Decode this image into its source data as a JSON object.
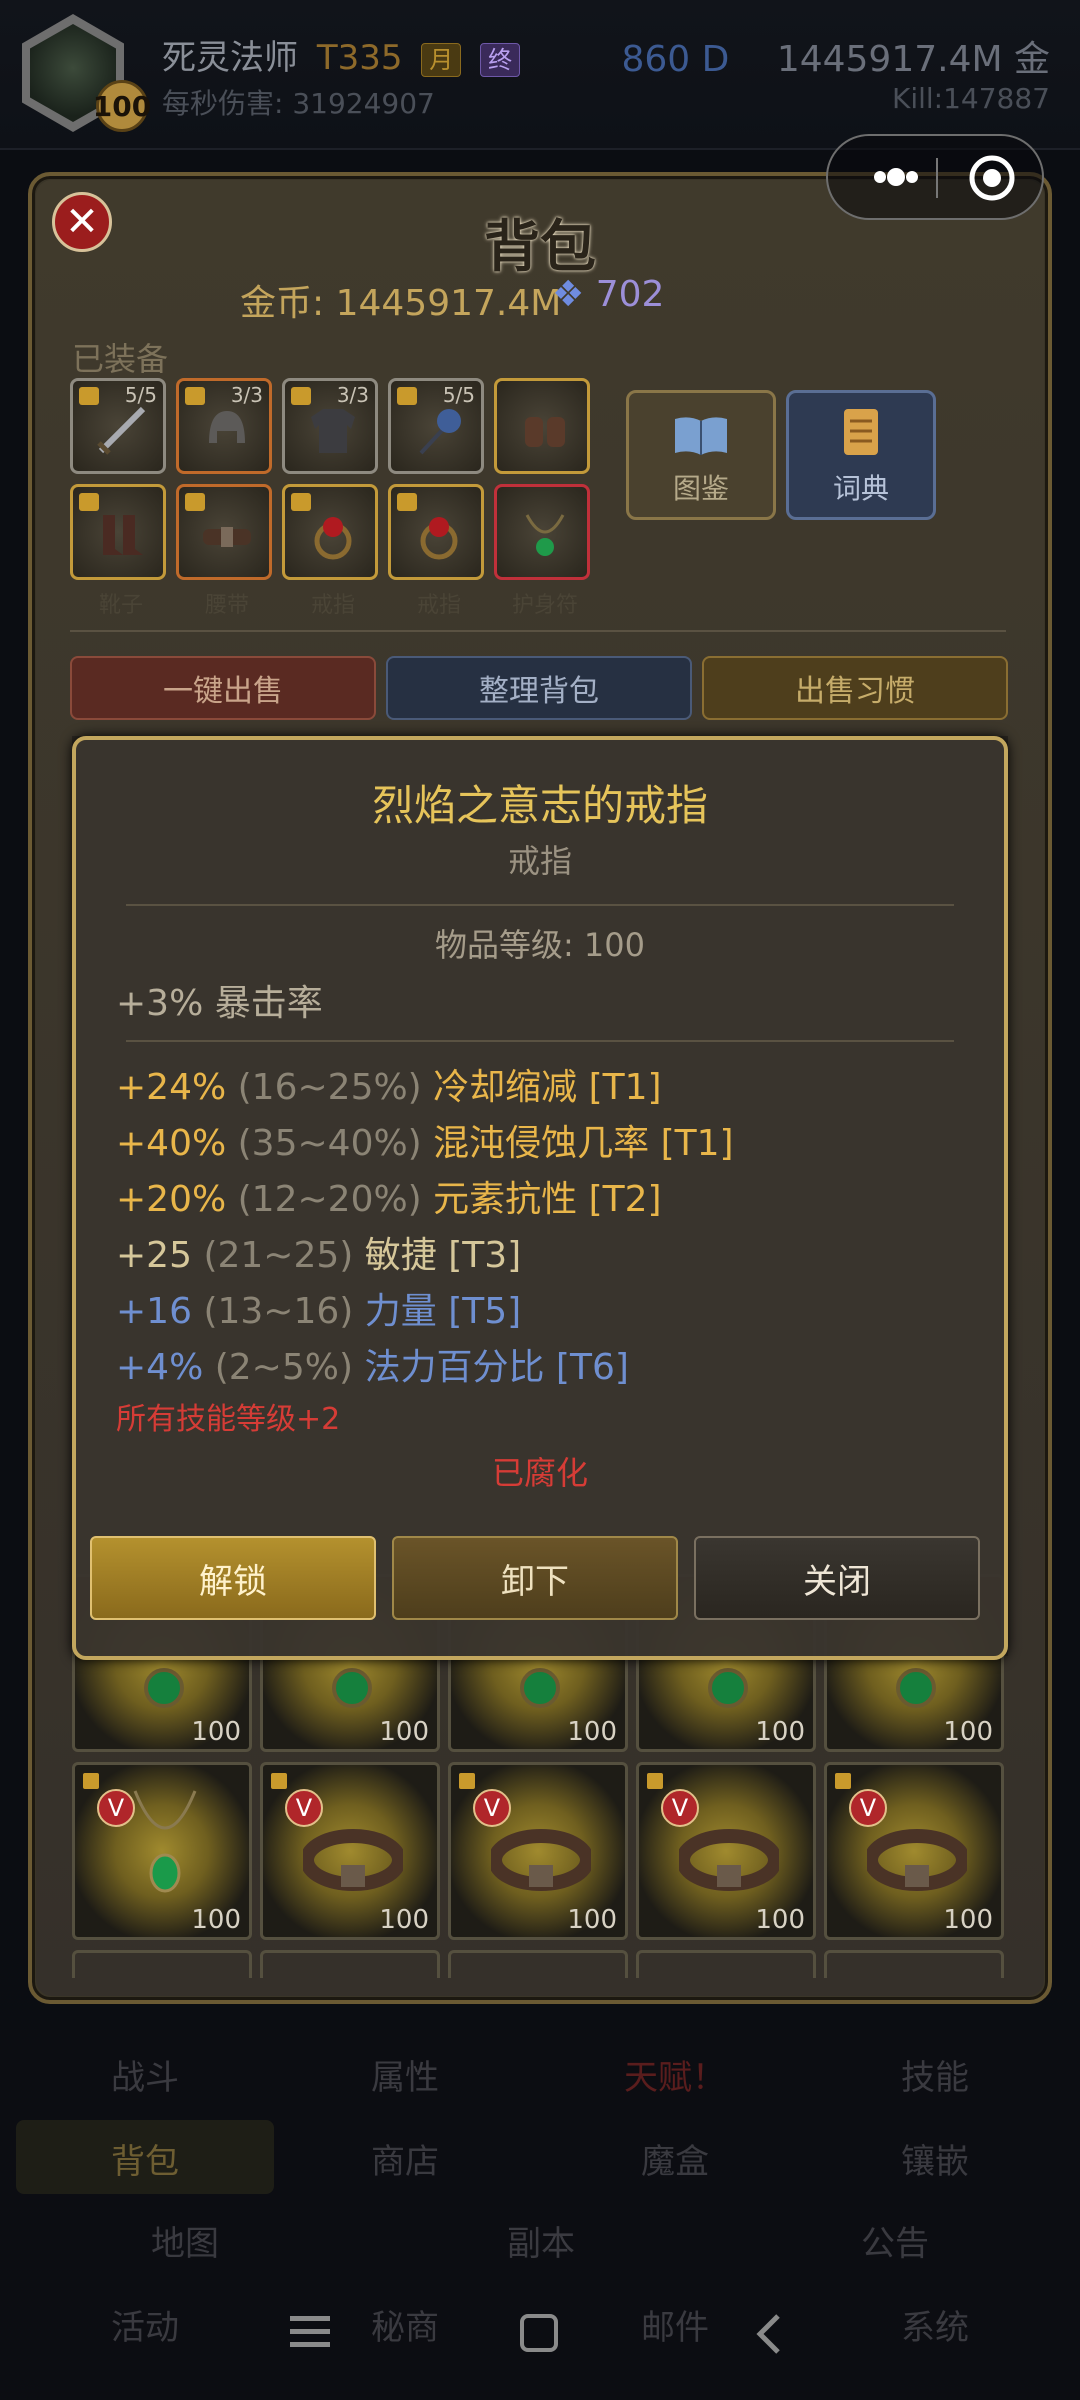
{
  "header": {
    "level": "100",
    "class_name": "死灵法师",
    "tier": "T335",
    "badge_month": "月",
    "badge_final": "终",
    "dps_text": "每秒伤害: 31924907",
    "diamonds": "860 D",
    "gold": "1445917.4M 金",
    "kills": "Kill:147887"
  },
  "panel": {
    "title": "背包",
    "gold_text": "金币: 1445917.4M",
    "gem_count": "702",
    "equipped_label": "已装备",
    "slots": [
      {
        "count": "5/5",
        "label": ""
      },
      {
        "count": "3/3",
        "label": ""
      },
      {
        "count": "3/3",
        "label": ""
      },
      {
        "count": "5/5",
        "label": ""
      },
      {
        "count": "",
        "label": ""
      },
      {
        "count": "",
        "label": "靴子"
      },
      {
        "count": "",
        "label": "腰带"
      },
      {
        "count": "",
        "label": "戒指"
      },
      {
        "count": "",
        "label": "戒指"
      },
      {
        "count": "",
        "label": "护身符"
      }
    ],
    "codex_label": "图鉴",
    "dict_label": "词典",
    "sell_all": "一键出售",
    "sort_bag": "整理背包",
    "sell_habit": "出售习惯"
  },
  "tooltip": {
    "name": "烈焰之意志的戒指",
    "type": "戒指",
    "item_level": "物品等级: 100",
    "implicit": "+3% 暴击率",
    "stats": [
      {
        "val": "+24%",
        "range": "(16~25%)",
        "name": "冷却缩减 [T1]",
        "color": "#e9b64a"
      },
      {
        "val": "+40%",
        "range": "(35~40%)",
        "name": "混沌侵蚀几率 [T1]",
        "color": "#e9b64a"
      },
      {
        "val": "+20%",
        "range": "(12~20%)",
        "name": "元素抗性 [T2]",
        "color": "#e9b64a"
      },
      {
        "val": "+25",
        "range": "(21~25)",
        "name": "敏捷 [T3]",
        "color": "#d6c79a"
      },
      {
        "val": "+16",
        "range": "(13~16)",
        "name": "力量 [T5]",
        "color": "#6f8fd0"
      },
      {
        "val": "+4%",
        "range": "(2~5%)",
        "name": "法力百分比 [T6]",
        "color": "#6f8fd0"
      }
    ],
    "special": "所有技能等级+2",
    "corrupted": "已腐化",
    "btn_unlock": "解锁",
    "btn_unequip": "卸下",
    "btn_close": "关闭"
  },
  "grid_levels": [
    "100",
    "100",
    "100",
    "100",
    "100",
    "100",
    "100",
    "100",
    "100",
    "100"
  ],
  "grid_badge": "V",
  "nav": {
    "row1": [
      "战斗",
      "属性",
      "天赋！",
      "技能"
    ],
    "row2": [
      "背包",
      "商店",
      "魔盒",
      "镶嵌"
    ],
    "row3": [
      "地图",
      "副本",
      "公告"
    ],
    "row4": [
      "活动",
      "秘商",
      "邮件",
      "系统"
    ]
  }
}
